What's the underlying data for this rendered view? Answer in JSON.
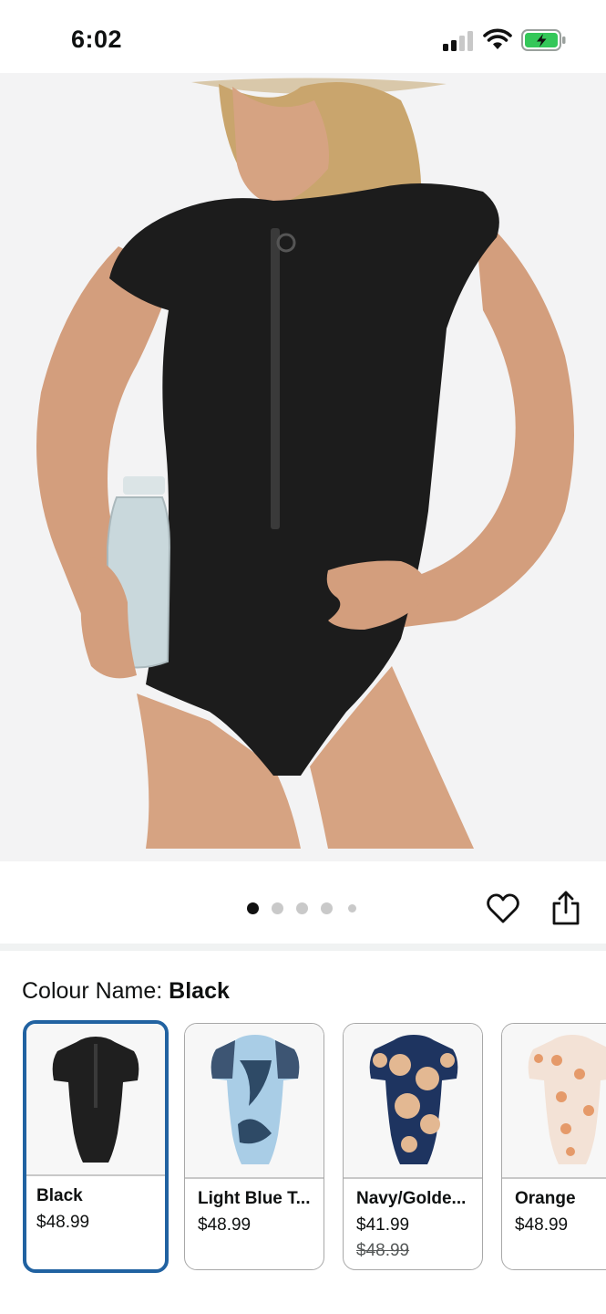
{
  "status_bar": {
    "time": "6:02"
  },
  "gallery": {
    "image_count": 5,
    "active_index": 0
  },
  "colour": {
    "label": "Colour Name: ",
    "selected": "Black"
  },
  "swatches": [
    {
      "name": "Black",
      "price": "$48.99"
    },
    {
      "name": "Light Blue T...",
      "price": "$48.99"
    },
    {
      "name": "Navy/Golde...",
      "price": "$41.99",
      "list_price": "$48.99"
    },
    {
      "name": "Orange",
      "price": "$48.99"
    }
  ],
  "icons": {
    "favorite": "heart-icon",
    "share": "share-icon"
  },
  "colors": {
    "selected_border": "#2162a1",
    "battery_green": "#34c759"
  }
}
